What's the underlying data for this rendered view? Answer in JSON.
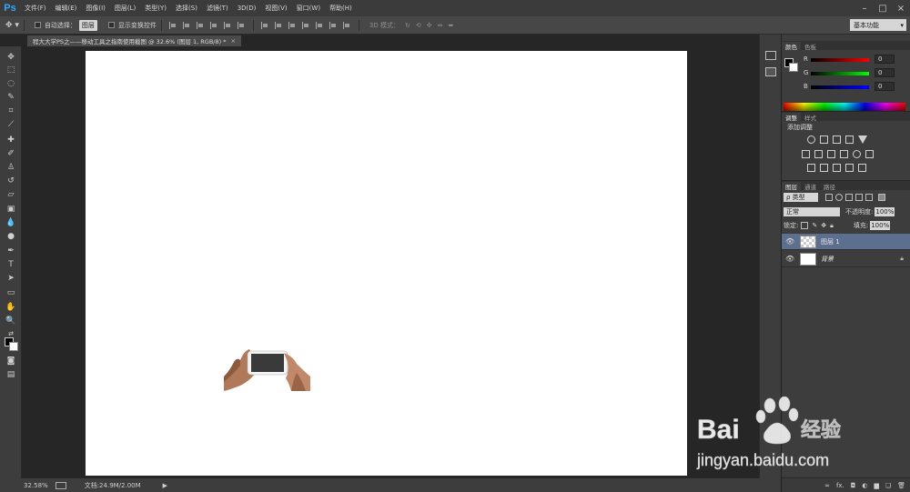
{
  "app": {
    "logo": "Ps"
  },
  "menu": [
    "文件(F)",
    "编辑(E)",
    "图像(I)",
    "图层(L)",
    "类型(Y)",
    "选择(S)",
    "滤镜(T)",
    "3D(D)",
    "视图(V)",
    "窗口(W)",
    "帮助(H)"
  ],
  "options": {
    "auto_select_label": "自动选择：",
    "auto_select_value": "图层",
    "show_transform_label": "显示变换控件",
    "mode_3d_label": "3D 模式：",
    "workspace": "基本功能"
  },
  "document": {
    "tab_title": "程大大学PS之——移动工具之指南使用截图 @ 32.6% (图层 1, RGB/8) *",
    "close": "×"
  },
  "status": {
    "zoom": "32.58%",
    "doc_size": "文档:24.9M/2.00M",
    "arrow": "▶"
  },
  "color_panel": {
    "tabs": [
      "颜色",
      "色板"
    ],
    "channels": [
      {
        "label": "R",
        "value": "0",
        "color": "#e02020"
      },
      {
        "label": "G",
        "value": "0",
        "color": "#20c020"
      },
      {
        "label": "B",
        "value": "0",
        "color": "#2040e0"
      }
    ]
  },
  "adjustments_panel": {
    "tabs": [
      "调整",
      "样式"
    ],
    "title": "添加调整"
  },
  "layers_panel": {
    "tabs": [
      "图层",
      "通道",
      "路径"
    ],
    "filter_kind": "ρ 类型",
    "blend_mode": "正常",
    "opacity_label": "不透明度:",
    "opacity_value": "100%",
    "lock_label": "锁定:",
    "fill_label": "填充:",
    "fill_value": "100%",
    "layers": [
      {
        "name": "图层 1",
        "selected": true
      },
      {
        "name": "背景",
        "selected": false
      }
    ],
    "footer_icons": [
      "link-icon",
      "fx-icon",
      "mask-icon",
      "adjustment-icon",
      "folder-icon",
      "new-layer-icon",
      "trash-icon"
    ],
    "footer_fx": "fx."
  },
  "watermark": {
    "brand_left": "Bai",
    "brand_right": "经验",
    "url": "jingyan.baidu.com"
  }
}
